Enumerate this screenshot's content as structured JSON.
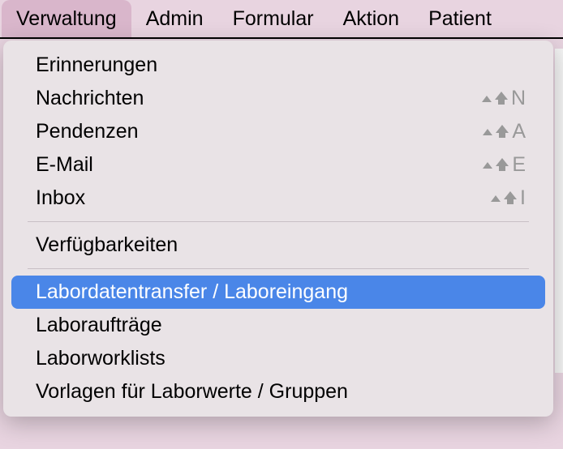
{
  "menubar": {
    "items": [
      {
        "label": "Verwaltung",
        "active": true
      },
      {
        "label": "Admin",
        "active": false
      },
      {
        "label": "Formular",
        "active": false
      },
      {
        "label": "Aktion",
        "active": false
      },
      {
        "label": "Patient",
        "active": false
      }
    ]
  },
  "dropdown": {
    "groups": [
      [
        {
          "label": "Erinnerungen",
          "shortcut": null
        },
        {
          "label": "Nachrichten",
          "shortcut": "N"
        },
        {
          "label": "Pendenzen",
          "shortcut": "A"
        },
        {
          "label": "E-Mail",
          "shortcut": "E"
        },
        {
          "label": "Inbox",
          "shortcut": "I"
        }
      ],
      [
        {
          "label": "Verfügbarkeiten",
          "shortcut": null
        }
      ],
      [
        {
          "label": "Labordatentransfer / Laboreingang",
          "shortcut": null,
          "highlighted": true
        },
        {
          "label": "Laboraufträge",
          "shortcut": null
        },
        {
          "label": "Laborworklists",
          "shortcut": null
        },
        {
          "label": "Vorlagen für Laborwerte / Gruppen",
          "shortcut": null
        }
      ]
    ]
  }
}
